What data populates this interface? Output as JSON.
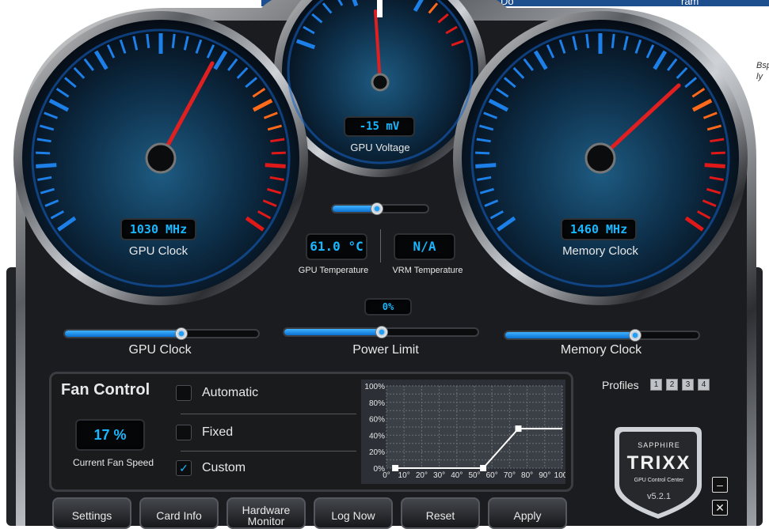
{
  "voltage": {
    "value": "-15 mV",
    "label": "GPU Voltage"
  },
  "gpu_clock_gauge": {
    "value": "1030 MHz",
    "label": "GPU Clock"
  },
  "memory_clock_gauge": {
    "value": "1460 MHz",
    "label": "Memory Clock"
  },
  "gpu_temperature": {
    "value": "61.0 °C",
    "label": "GPU Temperature"
  },
  "vrm_temperature": {
    "value": "N/A",
    "label": "VRM Temperature"
  },
  "power_limit": {
    "value": "0%",
    "label": "Power Limit",
    "level": 0.5
  },
  "gpu_clock_slider": {
    "label": "GPU Clock",
    "level": 0.6
  },
  "memory_clock_slider": {
    "label": "Memory Clock",
    "level": 0.67
  },
  "voltage_slider": {
    "level": 0.46
  },
  "fan": {
    "title": "Fan Control",
    "current_speed": "17 %",
    "current_speed_label": "Current Fan Speed",
    "modes": [
      {
        "label": "Automatic",
        "checked": false
      },
      {
        "label": "Fixed",
        "checked": false
      },
      {
        "label": "Custom",
        "checked": true
      }
    ],
    "curve": {
      "y_ticks": [
        "100%",
        "80%",
        "60%",
        "40%",
        "20%",
        "0%"
      ],
      "x_ticks": [
        "0°",
        "10°",
        "20°",
        "30°",
        "40°",
        "50°",
        "60°",
        "70°",
        "80°",
        "90°",
        "100°"
      ],
      "points": [
        [
          5,
          0
        ],
        [
          55,
          0
        ],
        [
          75,
          48
        ],
        [
          100,
          48
        ]
      ]
    }
  },
  "profiles": {
    "label": "Profiles",
    "items": [
      "1",
      "2",
      "3",
      "4"
    ]
  },
  "logo": {
    "brand": "SAPPHIRE",
    "product": "TRIXX",
    "subtitle": "GPU Control Center",
    "version": "v5.2.1"
  },
  "buttons": [
    "Settings",
    "Card Info",
    "Hardware Monitor",
    "Log Now",
    "Reset",
    "Apply"
  ],
  "window": {
    "minimize": "–",
    "close": "✕"
  },
  "background": {
    "snippet": "Bsp\nly",
    "snippet_top": "Do",
    "snippet_top2": "ram"
  },
  "colors": {
    "accent": "#19b7ff",
    "needle": "#e02020"
  }
}
